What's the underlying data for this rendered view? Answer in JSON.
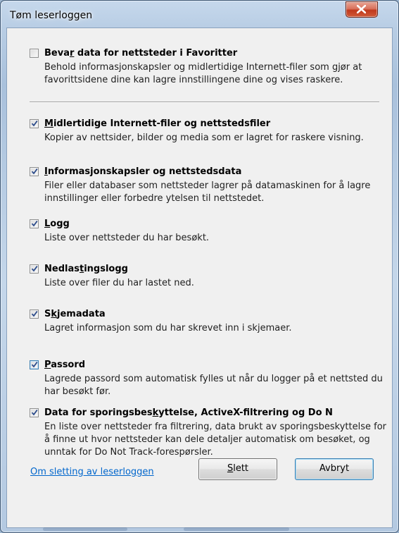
{
  "window": {
    "title": "Tøm leserloggen",
    "close_label": "X"
  },
  "favorites_option": {
    "checked": false,
    "title_before": "Beva",
    "title_access": "r",
    "title_after": " data for nettsteder i Favoritter",
    "description": "Behold informasjonskapsler og midlertidige Internett-filer som gjør at favorittsidene dine kan lagre innstillingene dine og vises raskere."
  },
  "options": [
    {
      "checked": true,
      "title_before": "",
      "title_access": "M",
      "title_after": "idlertidige Internett-filer og nettstedsfiler",
      "description": "Kopier av nettsider, bilder og media som er lagret for raskere visning."
    },
    {
      "checked": true,
      "title_before": "",
      "title_access": "I",
      "title_after": "nformasjonskapsler og nettstedsdata",
      "description": "Filer eller databaser som nettsteder lagrer på datamaskinen for å lagre innstillinger eller forbedre ytelsen til nettstedet."
    },
    {
      "checked": true,
      "title_before": "",
      "title_access": "L",
      "title_after": "ogg",
      "description": "Liste over nettsteder du har besøkt."
    },
    {
      "checked": true,
      "title_before": "Nedlas",
      "title_access": "t",
      "title_after": "ingslogg",
      "description": "Liste over filer du har lastet ned."
    },
    {
      "checked": true,
      "title_before": "S",
      "title_access": "k",
      "title_after": "jemadata",
      "description": "Lagret informasjon som du har skrevet inn i skjemaer."
    },
    {
      "checked": true,
      "title_before": "",
      "title_access": "P",
      "title_after": "assord",
      "description": "Lagrede passord som automatisk fylles ut når du logger på et nettsted du har besøkt før."
    },
    {
      "checked": true,
      "title_before": "Data for sporingsbes",
      "title_access": "k",
      "title_after": "yttelse, ActiveX-filtrering og Do N",
      "description": "En liste over nettsteder fra filtrering, data brukt av sporingsbeskyttelse for å finne ut hvor nettsteder kan dele detaljer automatisk om besøket, og unntak for Do Not Track-forespørsler."
    }
  ],
  "footer": {
    "link": "Om sletting av leserloggen",
    "delete_access": "S",
    "delete_rest": "lett",
    "cancel": "Avbryt"
  },
  "colors": {
    "link": "#0066cc",
    "check": "#2a4a8a",
    "close_button": "#c0391c"
  }
}
